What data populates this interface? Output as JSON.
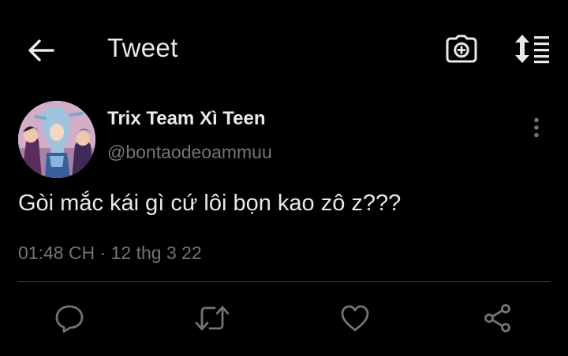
{
  "header": {
    "title": "Tweet",
    "back_icon": "arrow-left-icon",
    "camera_icon": "camera-plus-icon",
    "sort_icon": "sort-list-icon"
  },
  "tweet": {
    "author": {
      "display_name": "Trix Team Xì Teen",
      "handle": "@bontaodeoammuu"
    },
    "text": "Gòi mắc kái gì cứ lôi bọn kao zô z???",
    "timestamp": "01:48 CH · 12 thg 3 22"
  },
  "actions": [
    {
      "name": "reply",
      "icon": "reply-icon"
    },
    {
      "name": "retweet",
      "icon": "retweet-icon"
    },
    {
      "name": "like",
      "icon": "heart-icon"
    },
    {
      "name": "share",
      "icon": "share-icon"
    }
  ],
  "colors": {
    "background": "#000000",
    "text": "#e7e9ea",
    "secondary_text": "#6e767d",
    "divider": "#2f3336"
  }
}
